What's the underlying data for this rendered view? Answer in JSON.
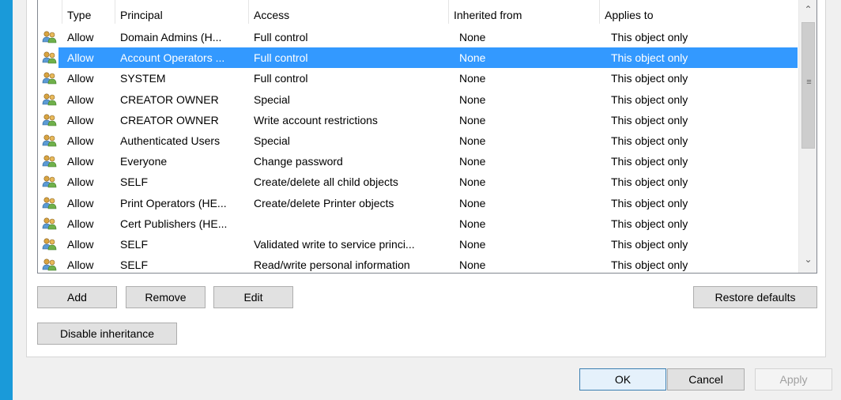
{
  "list": {
    "columns": {
      "type": "Type",
      "principal": "Principal",
      "access": "Access",
      "inherited": "Inherited from",
      "applies": "Applies to"
    },
    "rows": [
      {
        "type": "Allow",
        "principal": "Domain Admins (H...",
        "access": "Full control",
        "inherited": "None",
        "applies": "This object only",
        "selected": false
      },
      {
        "type": "Allow",
        "principal": "Account Operators ...",
        "access": "Full control",
        "inherited": "None",
        "applies": "This object only",
        "selected": true
      },
      {
        "type": "Allow",
        "principal": "SYSTEM",
        "access": "Full control",
        "inherited": "None",
        "applies": "This object only",
        "selected": false
      },
      {
        "type": "Allow",
        "principal": "CREATOR OWNER",
        "access": "Special",
        "inherited": "None",
        "applies": "This object only",
        "selected": false
      },
      {
        "type": "Allow",
        "principal": "CREATOR OWNER",
        "access": "Write account restrictions",
        "inherited": "None",
        "applies": "This object only",
        "selected": false
      },
      {
        "type": "Allow",
        "principal": "Authenticated Users",
        "access": "Special",
        "inherited": "None",
        "applies": "This object only",
        "selected": false
      },
      {
        "type": "Allow",
        "principal": "Everyone",
        "access": "Change password",
        "inherited": "None",
        "applies": "This object only",
        "selected": false
      },
      {
        "type": "Allow",
        "principal": "SELF",
        "access": "Create/delete all child objects",
        "inherited": "None",
        "applies": "This object only",
        "selected": false
      },
      {
        "type": "Allow",
        "principal": "Print Operators (HE...",
        "access": "Create/delete Printer objects",
        "inherited": "None",
        "applies": "This object only",
        "selected": false
      },
      {
        "type": "Allow",
        "principal": "Cert Publishers (HE...",
        "access": "",
        "inherited": "None",
        "applies": "This object only",
        "selected": false
      },
      {
        "type": "Allow",
        "principal": "SELF",
        "access": "Validated write to service princi...",
        "inherited": "None",
        "applies": "This object only",
        "selected": false
      },
      {
        "type": "Allow",
        "principal": "SELF",
        "access": "Read/write personal information",
        "inherited": "None",
        "applies": "This object only",
        "selected": false
      }
    ],
    "row_icon": "users-group-icon"
  },
  "buttons": {
    "add": "Add",
    "remove": "Remove",
    "edit": "Edit",
    "restore_defaults": "Restore defaults",
    "disable_inheritance": "Disable inheritance",
    "ok": "OK",
    "cancel": "Cancel",
    "apply": "Apply"
  },
  "colors": {
    "selection": "#3399ff",
    "window_accent": "#1a9ad9"
  }
}
